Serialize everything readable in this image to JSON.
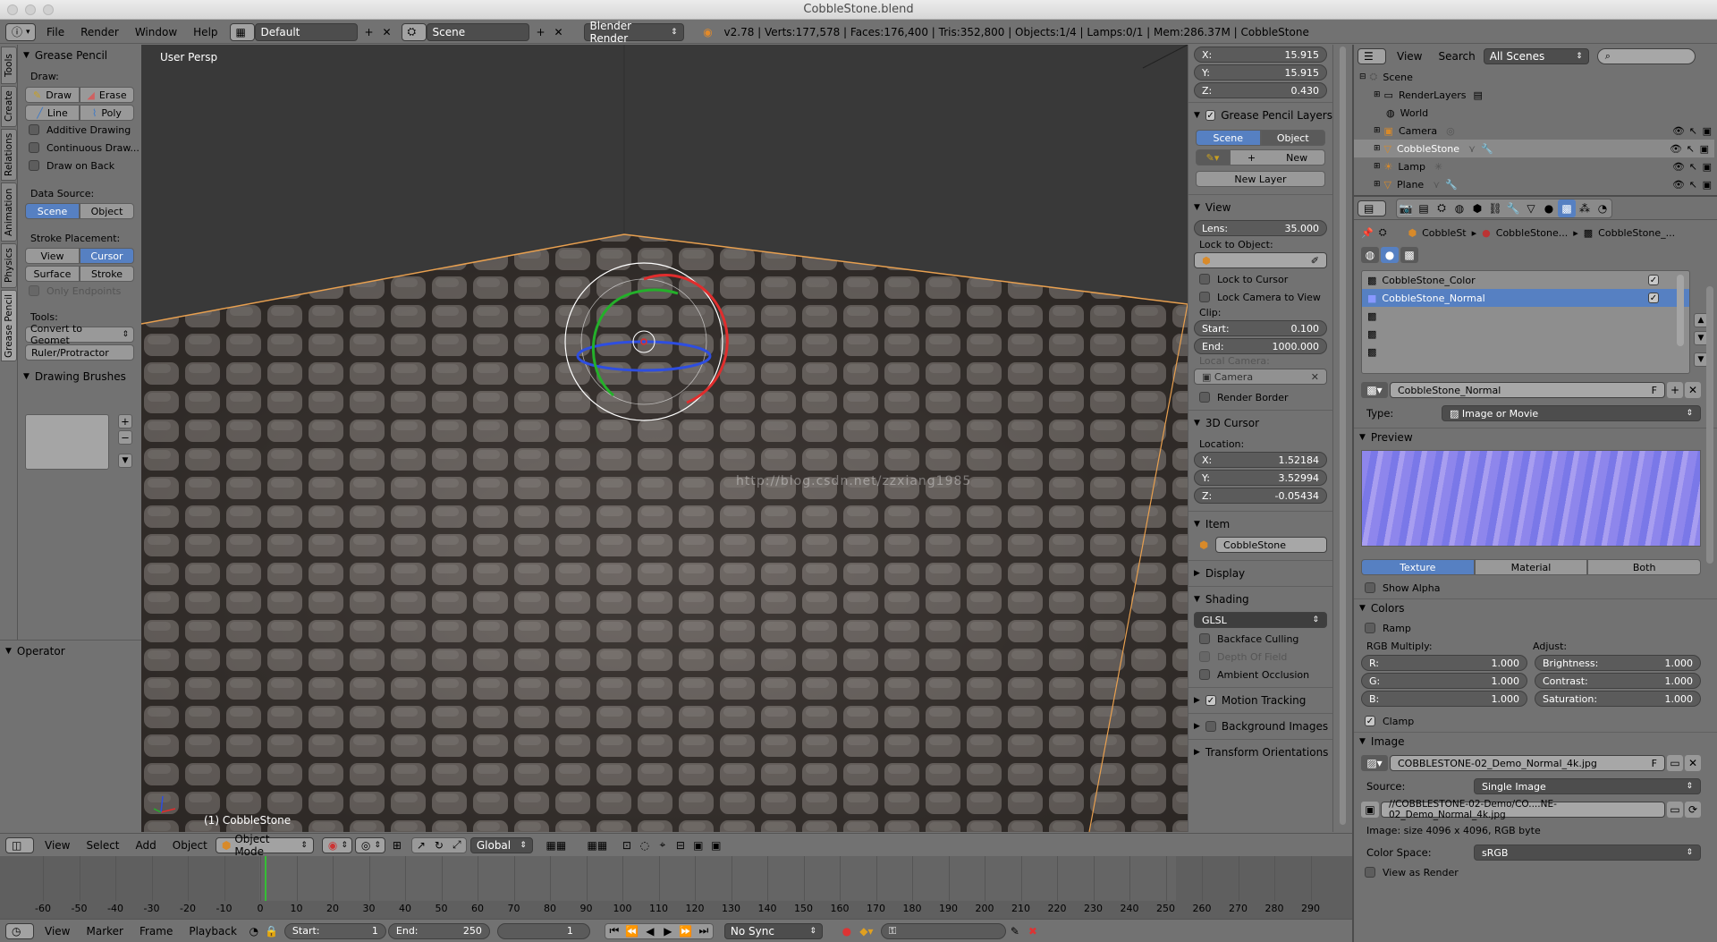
{
  "window": {
    "title": "CobbleStone.blend"
  },
  "topbar": {
    "menus": [
      "File",
      "Render",
      "Window",
      "Help"
    ],
    "layout": "Default",
    "scene": "Scene",
    "engine": "Blender Render",
    "info": "v2.78 | Verts:177,578 | Faces:176,400 | Tris:352,800 | Objects:1/4 | Lamps:0/1 | Mem:286.37M | CobbleStone"
  },
  "toolshelf": {
    "tabs": [
      "Tools",
      "Create",
      "Relations",
      "Animation",
      "Physics",
      "Grease Pencil"
    ],
    "grease_pencil": {
      "title": "Grease Pencil",
      "draw_label": "Draw:",
      "draw": "Draw",
      "erase": "Erase",
      "line": "Line",
      "poly": "Poly",
      "additive": "Additive Drawing",
      "continuous": "Continuous Draw...",
      "draw_on_back": "Draw on Back",
      "data_source": "Data Source:",
      "scene": "Scene",
      "object": "Object",
      "stroke_placement": "Stroke Placement:",
      "view": "View",
      "cursor": "Cursor",
      "surface": "Surface",
      "stroke": "Stroke",
      "only_endpoints": "Only Endpoints",
      "tools": "Tools:",
      "convert": "Convert to Geomet",
      "ruler": "Ruler/Protractor"
    },
    "drawing_brushes": "Drawing Brushes",
    "operator": "Operator"
  },
  "viewport": {
    "label": "User Persp",
    "object_label": "(1) CobbleStone",
    "watermark": "http://blog.csdn.net/zzxiang1985"
  },
  "npanel": {
    "loc": {
      "x_label": "X:",
      "x": "15.915",
      "y_label": "Y:",
      "y": "15.915",
      "z_label": "Z:",
      "z": "0.430"
    },
    "gp_layers": {
      "title": "Grease Pencil Layers",
      "scene": "Scene",
      "object": "Object",
      "new": "New",
      "new_layer": "New Layer"
    },
    "view": {
      "title": "View",
      "lens_label": "Lens:",
      "lens": "35.000",
      "lock_to_object": "Lock to Object:",
      "lock_cursor": "Lock to Cursor",
      "lock_camera": "Lock Camera to View",
      "clip": "Clip:",
      "start_label": "Start:",
      "start": "0.100",
      "end_label": "End:",
      "end": "1000.000",
      "local_camera": "Local Camera:",
      "camera": "Camera",
      "render_border": "Render Border"
    },
    "cursor3d": {
      "title": "3D Cursor",
      "location": "Location:",
      "x_label": "X:",
      "x": "1.52184",
      "y_label": "Y:",
      "y": "3.52994",
      "z_label": "Z:",
      "z": "-0.05434"
    },
    "item": {
      "title": "Item",
      "name": "CobbleStone"
    },
    "display": "Display",
    "shading": {
      "title": "Shading",
      "mode": "GLSL",
      "backface": "Backface Culling",
      "dof": "Depth Of Field",
      "ao": "Ambient Occlusion"
    },
    "motion_tracking": "Motion Tracking",
    "background_images": "Background Images",
    "transform_orientations": "Transform Orientations"
  },
  "outliner": {
    "view": "View",
    "search": "Search",
    "filter": "All Scenes",
    "items": [
      {
        "label": "Scene",
        "indent": 0
      },
      {
        "label": "RenderLayers",
        "indent": 1
      },
      {
        "label": "World",
        "indent": 1
      },
      {
        "label": "Camera",
        "indent": 1
      },
      {
        "label": "CobbleStone",
        "indent": 1
      },
      {
        "label": "Lamp",
        "indent": 1
      },
      {
        "label": "Plane",
        "indent": 1
      }
    ]
  },
  "properties": {
    "breadcrumb": [
      "CobbleSt",
      "CobbleStone...",
      "CobbleStone_..."
    ],
    "slots": [
      "CobbleStone_Color",
      "CobbleStone_Normal"
    ],
    "texture_name": "CobbleStone_Normal",
    "f_label": "F",
    "type_label": "Type:",
    "type": "Image or Movie",
    "preview": "Preview",
    "preview_tabs": [
      "Texture",
      "Material",
      "Both"
    ],
    "show_alpha": "Show Alpha",
    "colors": "Colors",
    "ramp": "Ramp",
    "rgb_multiply": "RGB Multiply:",
    "adjust": "Adjust:",
    "r_label": "R:",
    "r": "1.000",
    "g_label": "G:",
    "g": "1.000",
    "b_label": "B:",
    "b": "1.000",
    "brightness_label": "Brightness:",
    "brightness": "1.000",
    "contrast_label": "Contrast:",
    "contrast": "1.000",
    "saturation_label": "Saturation:",
    "saturation": "1.000",
    "clamp": "Clamp",
    "image": "Image",
    "image_name": "COBBLESTONE-02_Demo_Normal_4k.jpg",
    "source_label": "Source:",
    "source": "Single Image",
    "filepath": "//COBBLESTONE-02-Demo/CO....NE-02_Demo_Normal_4k.jpg",
    "image_size": "Image: size 4096 x 4096, RGB byte",
    "color_space_label": "Color Space:",
    "color_space": "sRGB",
    "view_as_render": "View as Render"
  },
  "vpheader": {
    "view": "View",
    "select": "Select",
    "add": "Add",
    "object": "Object",
    "mode": "Object Mode",
    "orientation": "Global"
  },
  "timeline": {
    "ticks": [
      "-60",
      "-50",
      "-40",
      "-30",
      "-20",
      "-10",
      "0",
      "10",
      "20",
      "30",
      "40",
      "50",
      "60",
      "70",
      "80",
      "90",
      "100",
      "110",
      "120",
      "130",
      "140",
      "150",
      "160",
      "170",
      "180",
      "190",
      "200",
      "210",
      "220",
      "230",
      "240",
      "250",
      "260",
      "270",
      "280",
      "290"
    ],
    "view": "View",
    "marker": "Marker",
    "frame": "Frame",
    "playback": "Playback",
    "start_label": "Start:",
    "start": "1",
    "end_label": "End:",
    "end": "250",
    "current": "1",
    "sync": "No Sync"
  },
  "colors": {
    "accent": "#5680c2",
    "viewport_bg": "#393939",
    "object_outline": "#e8a050"
  }
}
